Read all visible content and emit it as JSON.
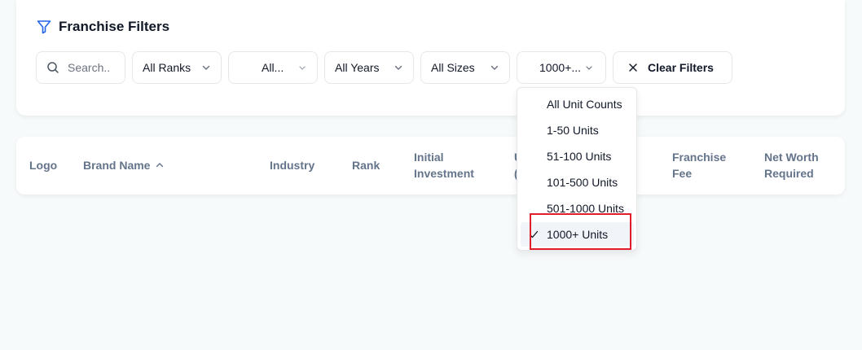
{
  "filters": {
    "title": "Franchise Filters",
    "search_placeholder": "Search..",
    "rank": "All Ranks",
    "industry": "All...",
    "years": "All Years",
    "sizes": "All Sizes",
    "units": "1000+...",
    "clear_label": "Clear Filters"
  },
  "table": {
    "headers": {
      "logo": "Logo",
      "brand_name": "Brand Name",
      "industry": "Industry",
      "rank": "Rank",
      "initial_investment_1": "Initial",
      "initial_investment_2": "Investment",
      "units_1": "U",
      "units_2": "(",
      "franchise_fee_1": "Franchise",
      "franchise_fee_2": "Fee",
      "net_worth_1": "Net Worth",
      "net_worth_2": "Required"
    }
  },
  "unit_dropdown": {
    "options": [
      "All Unit Counts",
      "1-50 Units",
      "51-100 Units",
      "101-500 Units",
      "501-1000 Units",
      "1000+ Units"
    ],
    "selected_index": 5
  },
  "colors": {
    "accent": "#2563eb",
    "highlight": "#e11d2a"
  }
}
